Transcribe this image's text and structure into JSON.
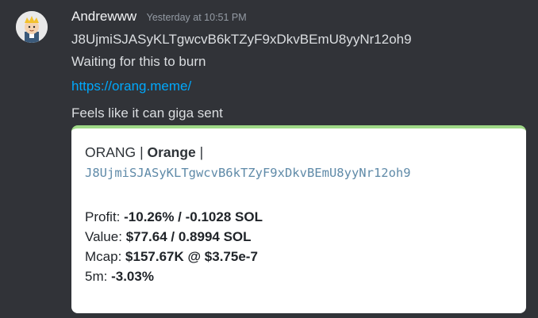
{
  "message": {
    "username": "Andrewww",
    "timestamp": "Yesterday at 10:51 PM",
    "lines": [
      "J8UjmiSJASyKLTgwcvB6kTZyF9xDkvBEmU8yyNr12oh9",
      "Waiting for this to burn"
    ],
    "link": "https://orang.meme/",
    "after_link": "Feels like it can giga sent"
  },
  "embed": {
    "ticker": "ORANG",
    "separator": "|",
    "name": "Orange",
    "trailing_separator": "|",
    "address": "J8UjmiSJASyKLTgwcvB6kTZyF9xDkvBEmU8yyNr12oh9",
    "accent_color": "#9fd987",
    "rows": [
      {
        "label": "Profit:",
        "value": "-10.26% / -0.1028 SOL"
      },
      {
        "label": "Value:",
        "value": "$77.64 / 0.8994 SOL"
      },
      {
        "label": "Mcap:",
        "value": "$157.67K @ $3.75e-7"
      },
      {
        "label": "5m:",
        "value": "-3.03%"
      }
    ]
  }
}
